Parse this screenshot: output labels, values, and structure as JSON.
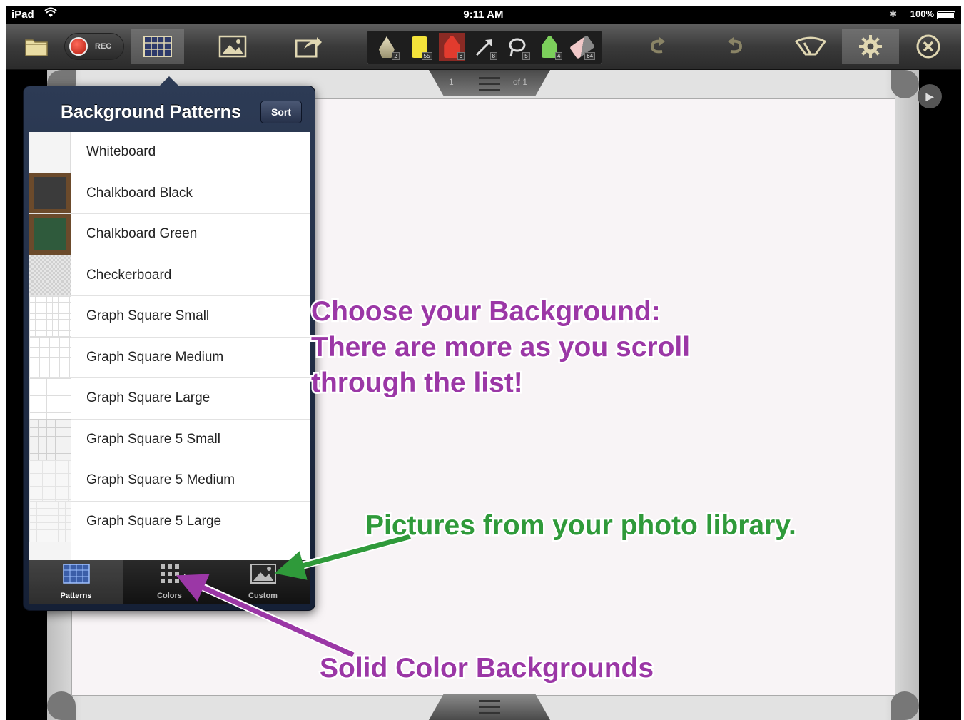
{
  "status_bar": {
    "device": "iPad",
    "time": "9:11 AM",
    "battery": "100%"
  },
  "toolbar": {
    "rec_label": "REC",
    "tools": [
      {
        "icon": "pen-icon",
        "color": "#e8e0c0",
        "count": "2"
      },
      {
        "icon": "highlighter-yellow-icon",
        "color": "#f3e23a",
        "count": "55"
      },
      {
        "icon": "marker-red-icon",
        "color": "#e23b2e",
        "count": "8"
      },
      {
        "icon": "arrow-tool-icon",
        "color": "#111111",
        "count": "8"
      },
      {
        "icon": "lasso-icon",
        "color": "#111111",
        "count": "5"
      },
      {
        "icon": "marker-green-icon",
        "color": "#7ccf5b",
        "count": "4"
      },
      {
        "icon": "eraser-icon",
        "color": "#f0c8c8",
        "count": "64"
      }
    ]
  },
  "page_indicator": {
    "current": "1",
    "total": "of 1"
  },
  "popover": {
    "title": "Background Patterns",
    "sort_label": "Sort",
    "items": [
      {
        "label": "Whiteboard",
        "thumb": "#f4f4f4"
      },
      {
        "label": "Chalkboard Black",
        "thumb": "#3b3b3b"
      },
      {
        "label": "Chalkboard Green",
        "thumb": "#2f5a3c"
      },
      {
        "label": "Checkerboard",
        "thumb": "#d8d8d8"
      },
      {
        "label": "Graph Square Small",
        "thumb": "#ffffff"
      },
      {
        "label": "Graph Square Medium",
        "thumb": "#ffffff"
      },
      {
        "label": "Graph Square Large",
        "thumb": "#ffffff"
      },
      {
        "label": "Graph Square 5 Small",
        "thumb": "#f2f2f2"
      },
      {
        "label": "Graph Square 5 Medium",
        "thumb": "#f7f7f7"
      },
      {
        "label": "Graph Square 5 Large",
        "thumb": "#f7f7f7"
      }
    ],
    "tabs": [
      {
        "label": "Patterns",
        "icon": "patterns-icon"
      },
      {
        "label": "Colors",
        "icon": "grid-icon"
      },
      {
        "label": "Custom",
        "icon": "picture-icon"
      }
    ]
  },
  "annotations": {
    "choose_line1": "Choose your Background:",
    "choose_line2": "There are more as you scroll",
    "choose_line3": "through the list!",
    "pictures": "Pictures from your photo library.",
    "solid": "Solid Color Backgrounds"
  },
  "colors": {
    "purple": "#9b37a6",
    "green": "#2f9a3a"
  }
}
